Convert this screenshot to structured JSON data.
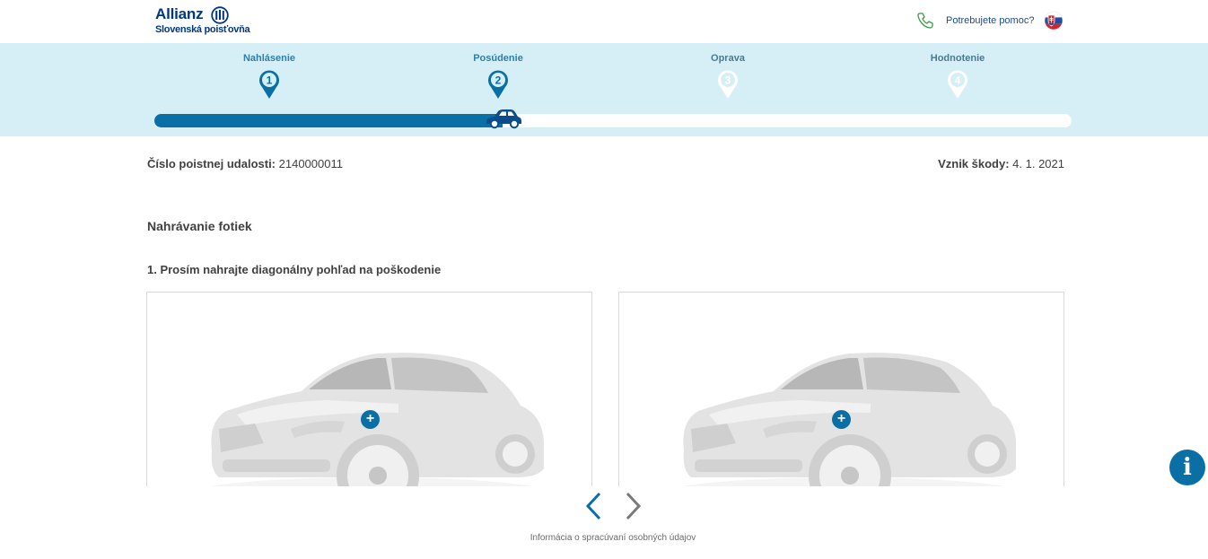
{
  "header": {
    "logo_name": "Allianz",
    "logo_subtitle": "Slovenská poisťovňa",
    "help_text": "Potrebujete pomoc?",
    "help_icon": "phone-icon",
    "language_icon": "slovak-flag-icon"
  },
  "stepper": {
    "steps": [
      {
        "label": "Nahlásenie",
        "number": "1",
        "state": "done"
      },
      {
        "label": "Posúdenie",
        "number": "2",
        "state": "current"
      },
      {
        "label": "Oprava",
        "number": "3",
        "state": "upcoming"
      },
      {
        "label": "Hodnotenie",
        "number": "4",
        "state": "upcoming"
      }
    ],
    "progress": 0.38,
    "progress_icon": "car-icon",
    "colors": {
      "active": "#0a6fa5",
      "inactive": "#ffffff",
      "background": "#d6eff6"
    }
  },
  "claim": {
    "number_label": "Číslo poistnej udalosti:",
    "number_value": "2140000011",
    "damage_label": "Vznik škody:",
    "damage_value": "4. 1. 2021"
  },
  "upload": {
    "title": "Nahrávanie fotiek",
    "instruction": "1. Prosím nahrajte diagonálny pohľad na poškodenie",
    "cards": [
      {
        "image": "car-diagonal-photo",
        "add_icon": "plus-icon"
      },
      {
        "image": "car-diagonal-photo",
        "add_icon": "plus-icon"
      }
    ]
  },
  "carousel": {
    "prev_icon": "chevron-left-icon",
    "next_icon": "chevron-right-icon"
  },
  "footer": {
    "privacy_link": "Informácia o spracúvaní osobných údajov"
  },
  "info_button": {
    "glyph": "i",
    "icon": "info-icon"
  },
  "colors": {
    "brand": "#003781",
    "accent": "#0a6fa5",
    "text": "#414141"
  }
}
